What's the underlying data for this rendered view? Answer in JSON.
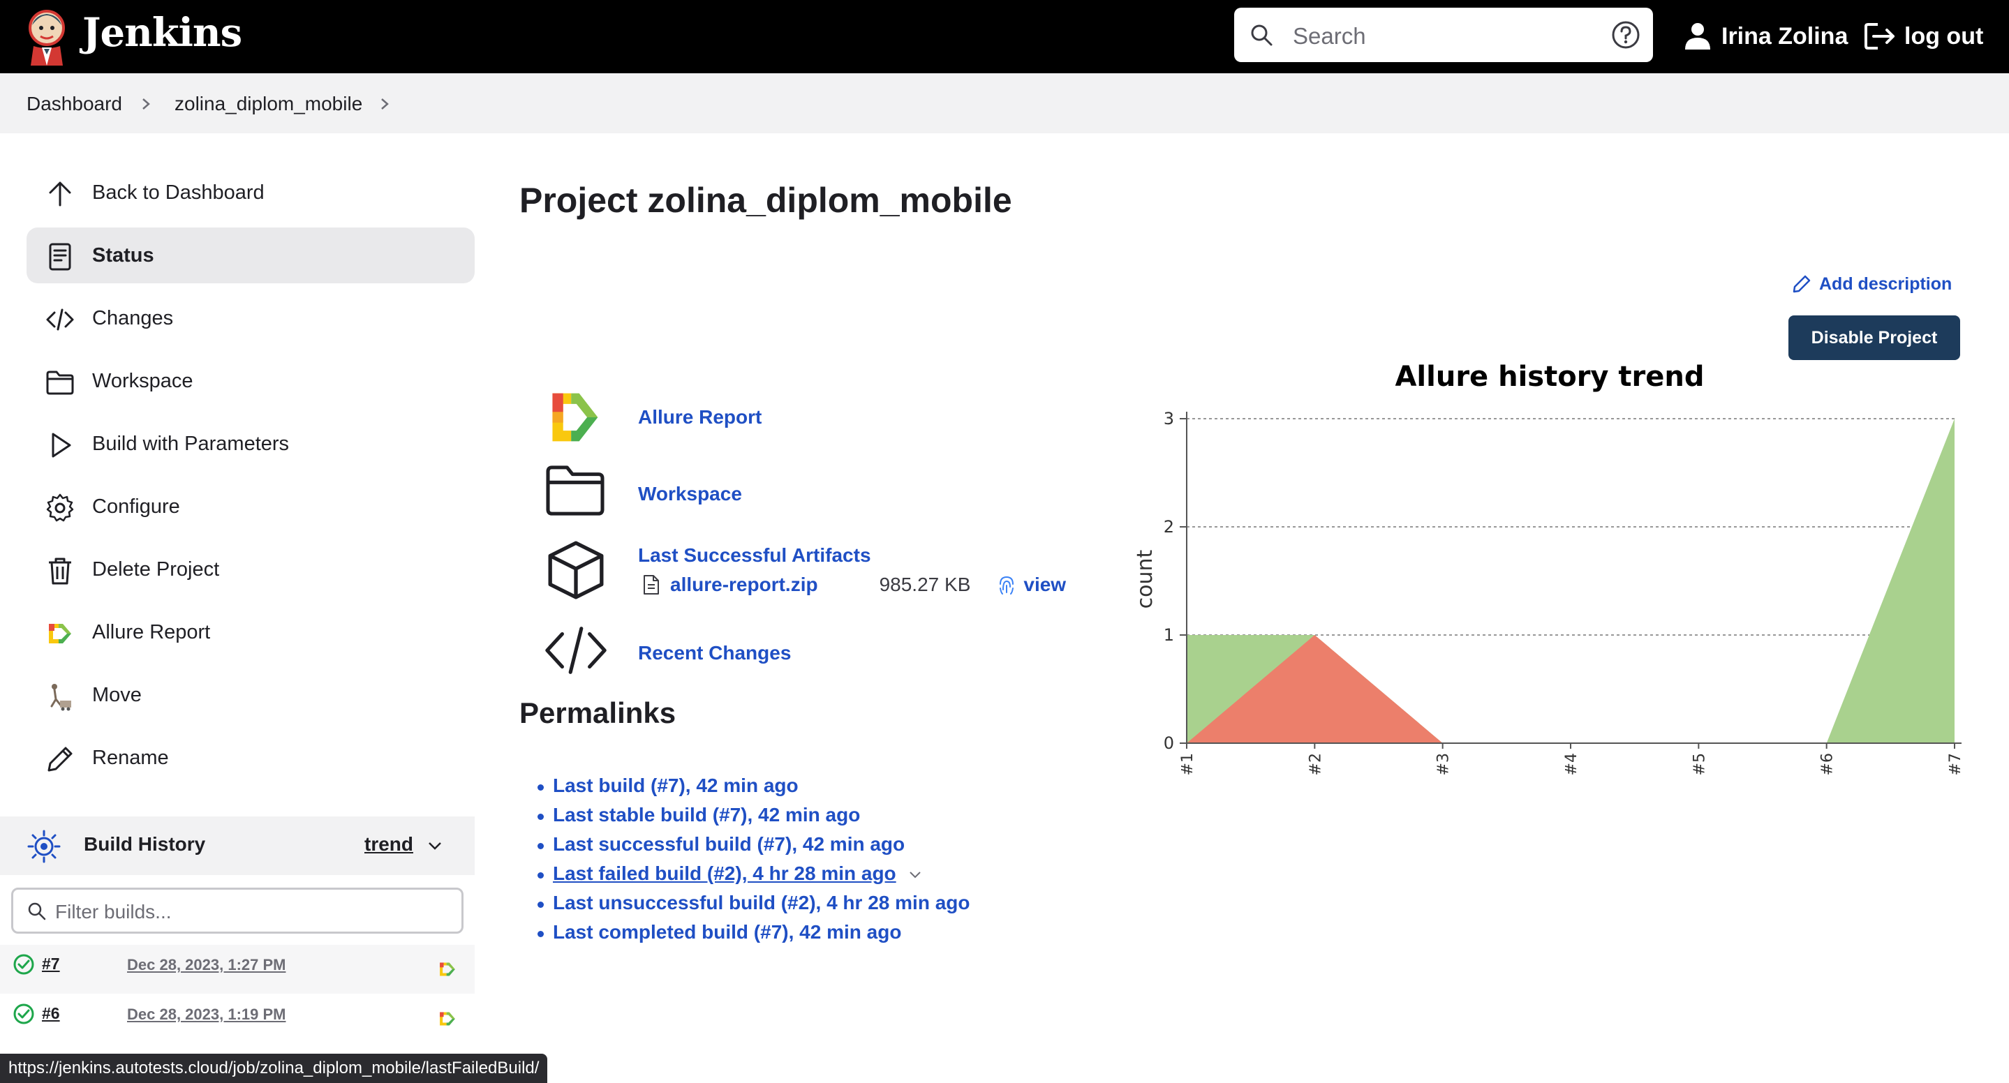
{
  "header": {
    "brand": "Jenkins",
    "logo_icon": "jenkins-butler-logo",
    "search": {
      "placeholder": "Search",
      "icon": "search-icon",
      "help_icon": "help-circle-icon"
    },
    "user": {
      "name": "Irina Zolina",
      "icon": "user-icon"
    },
    "logout": {
      "label": "log out",
      "icon": "logout-icon"
    }
  },
  "breadcrumb": [
    "Dashboard",
    "zolina_diplom_mobile"
  ],
  "sidebar": {
    "items": [
      {
        "label": "Back to Dashboard",
        "icon": "arrow-up-icon"
      },
      {
        "label": "Status",
        "icon": "document-icon",
        "active": true
      },
      {
        "label": "Changes",
        "icon": "code-icon"
      },
      {
        "label": "Workspace",
        "icon": "folder-icon"
      },
      {
        "label": "Build with Parameters",
        "icon": "play-icon"
      },
      {
        "label": "Configure",
        "icon": "gear-icon"
      },
      {
        "label": "Delete Project",
        "icon": "trash-icon"
      },
      {
        "label": "Allure Report",
        "icon": "allure-icon"
      },
      {
        "label": "Move",
        "icon": "move-icon"
      },
      {
        "label": "Rename",
        "icon": "pencil-icon"
      }
    ]
  },
  "build_history": {
    "title": "Build History",
    "trend_label": "trend",
    "filter_placeholder": "Filter builds...",
    "builds": [
      {
        "number": "#7",
        "date": "Dec 28, 2023, 1:27 PM",
        "status": "success"
      },
      {
        "number": "#6",
        "date": "Dec 28, 2023, 1:19 PM",
        "status": "success"
      }
    ]
  },
  "status_bar_url": "https://jenkins.autotests.cloud/job/zolina_diplom_mobile/lastFailedBuild/",
  "main": {
    "title": "Project zolina_diplom_mobile",
    "add_description": "Add description",
    "disable_button": "Disable Project",
    "links": {
      "allure_report": "Allure Report",
      "workspace": "Workspace",
      "last_successful_artifacts": "Last Successful Artifacts",
      "artifact_file": "allure-report.zip",
      "artifact_size": "985.27 KB",
      "artifact_view": "view",
      "recent_changes": "Recent Changes"
    },
    "permalinks_title": "Permalinks",
    "permalinks": [
      "Last build (#7), 42 min ago",
      "Last stable build (#7), 42 min ago",
      "Last successful build (#7), 42 min ago",
      "Last failed build (#2), 4 hr 28 min ago",
      "Last unsuccessful build (#2), 4 hr 28 min ago",
      "Last completed build (#7), 42 min ago"
    ]
  },
  "colors": {
    "header_bg": "#000000",
    "link": "#1f4fc4",
    "disable_button_bg": "#1d3b5b",
    "passed": "#a9d18e",
    "failed": "#ec7f6b"
  },
  "chart_data": {
    "type": "area",
    "title": "Allure history trend",
    "xlabel": "",
    "ylabel": "count",
    "x": [
      "#1",
      "#2",
      "#3",
      "#4",
      "#5",
      "#6",
      "#7"
    ],
    "ylim": [
      0,
      3
    ],
    "yticks": [
      "0",
      "1",
      "2",
      "3"
    ],
    "grid": true,
    "series": [
      {
        "key": "passed",
        "values": [
          1,
          1,
          0,
          0,
          0,
          0,
          3
        ],
        "color": "#a9d18e"
      },
      {
        "key": "failed",
        "values": [
          0,
          1,
          0,
          0,
          0,
          0,
          0
        ],
        "color": "#ec7f6b"
      }
    ]
  }
}
